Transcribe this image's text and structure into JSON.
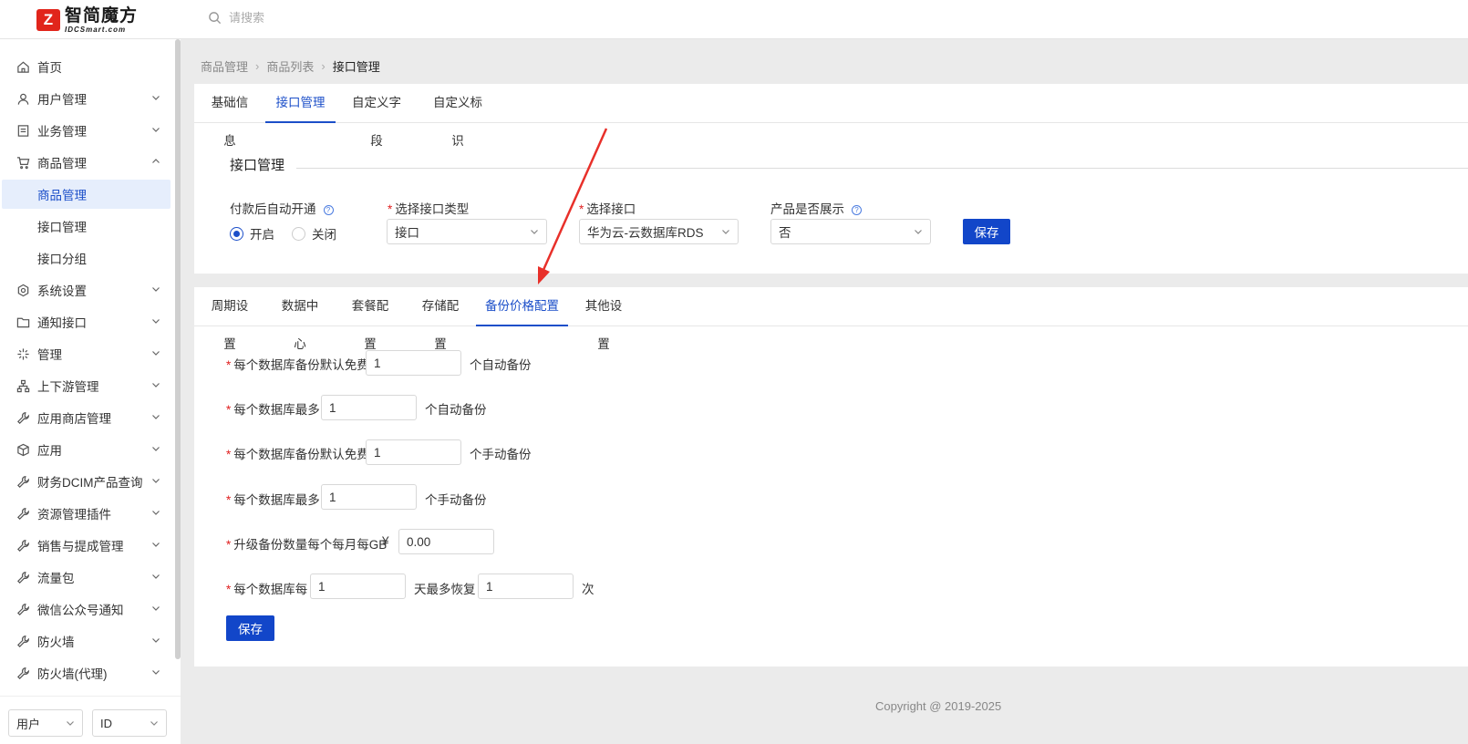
{
  "brand": {
    "title": "智简魔方",
    "sub": "IDCSmart.com"
  },
  "search": {
    "placeholder": "请搜索"
  },
  "sidebar": {
    "items": [
      {
        "label": "首页",
        "icon": "home-icon"
      },
      {
        "label": "用户管理",
        "icon": "user-icon"
      },
      {
        "label": "业务管理",
        "icon": "list-icon"
      },
      {
        "label": "商品管理",
        "icon": "cart-icon"
      },
      {
        "label": "系统设置",
        "icon": "settings-icon"
      },
      {
        "label": "通知接口",
        "icon": "folder-icon"
      },
      {
        "label": "管理",
        "icon": "sparkle-icon"
      },
      {
        "label": "上下游管理",
        "icon": "hierarchy-icon"
      },
      {
        "label": "应用商店管理",
        "icon": "wrench-icon"
      },
      {
        "label": "应用",
        "icon": "box-icon"
      },
      {
        "label": "财务DCIM产品查询",
        "icon": "wrench-icon"
      },
      {
        "label": "资源管理插件",
        "icon": "wrench-icon"
      },
      {
        "label": "销售与提成管理",
        "icon": "wrench-icon"
      },
      {
        "label": "流量包",
        "icon": "wrench-icon"
      },
      {
        "label": "微信公众号通知",
        "icon": "wrench-icon"
      },
      {
        "label": "防火墙",
        "icon": "wrench-icon"
      },
      {
        "label": "防火墙(代理)",
        "icon": "wrench-icon"
      }
    ],
    "sub_items": [
      "商品管理",
      "接口管理",
      "接口分组"
    ],
    "bottom": {
      "select1": "用户",
      "select2": "ID"
    }
  },
  "breadcrumb": [
    "商品管理",
    "商品列表",
    "接口管理"
  ],
  "top_tabs": [
    "基础信息",
    "接口管理",
    "自定义字段",
    "自定义标识"
  ],
  "interface": {
    "section_title": "接口管理",
    "auto_open_label": "付款后自动开通",
    "radio_on": "开启",
    "radio_off": "关闭",
    "type_label": "选择接口类型",
    "type_value": "接口",
    "iface_label": "选择接口",
    "iface_value": "华为云-云数据库RDS",
    "show_label": "产品是否展示",
    "show_value": "否",
    "save": "保存"
  },
  "config_tabs": [
    "周期设置",
    "数据中心",
    "套餐配置",
    "存储配置",
    "备份价格配置",
    "其他设置"
  ],
  "backup": {
    "f1_label": "每个数据库备份默认免费",
    "f1_value": "1",
    "f1_suffix": "个自动备份",
    "f2_label": "每个数据库最多",
    "f2_value": "1",
    "f2_suffix": "个自动备份",
    "f3_label": "每个数据库备份默认免费",
    "f3_value": "1",
    "f3_suffix": "个手动备份",
    "f4_label": "每个数据库最多",
    "f4_value": "1",
    "f4_suffix": "个手动备份",
    "f5_label": "升级备份数量每个每月每GB",
    "f5_currency": "¥",
    "f5_value": "0.00",
    "f6_label": "每个数据库每",
    "f6_value": "1",
    "f6_mid": "天最多恢复",
    "f6_value2": "1",
    "f6_suffix": "次",
    "save": "保存"
  },
  "footer": "Copyright @ 2019-2025",
  "colors": {
    "accent": "#1c4fc9",
    "button": "#1246c9",
    "required": "#e02020",
    "annotation_arrow": "#e8302a"
  }
}
